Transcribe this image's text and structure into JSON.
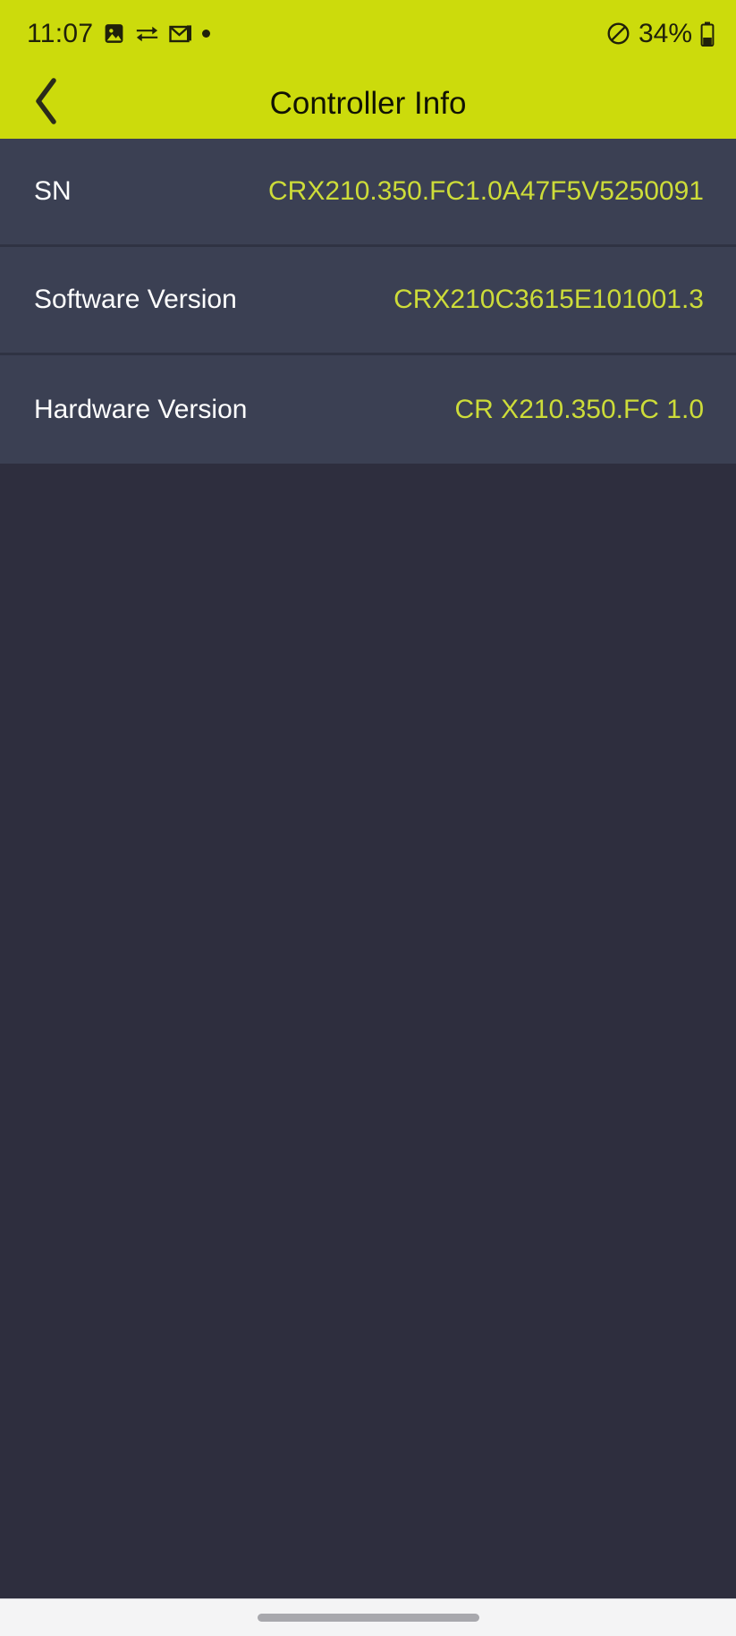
{
  "status_bar": {
    "time": "11:07",
    "icons": [
      "image-icon",
      "data-transfer-icon",
      "mail-icon",
      "dot-indicator-icon"
    ],
    "dnd_icon": "do-not-disturb-icon",
    "battery_percent": "34%",
    "battery_icon": "battery-icon"
  },
  "app_bar": {
    "back_icon": "back-chevron-icon",
    "title": "Controller Info"
  },
  "info_rows": [
    {
      "label": "SN",
      "value": "CRX210.350.FC1.0A47F5V5250091"
    },
    {
      "label": "Software Version",
      "value": "CRX210C3615E101001.3"
    },
    {
      "label": "Hardware Version",
      "value": "CR X210.350.FC 1.0"
    }
  ],
  "nav_bar": {
    "gesture_pill": "home-gesture-pill"
  },
  "colors": {
    "accent_lime": "#ccdb0c",
    "value_text": "#cddc39",
    "row_bg": "#3b4053",
    "page_bg": "#2e2e3e",
    "divider": "#2f3343",
    "nav_bg": "#f4f4f5"
  }
}
